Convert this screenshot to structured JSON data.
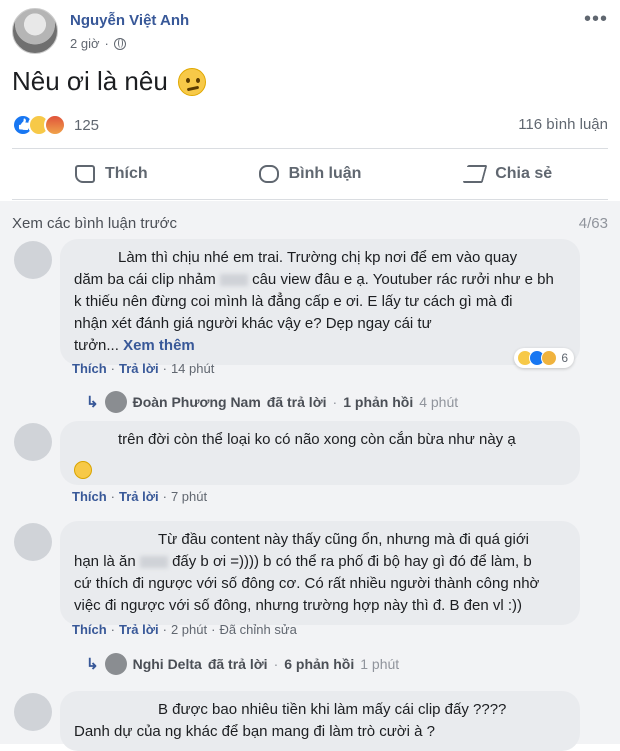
{
  "post": {
    "author": "Nguyễn Việt Anh",
    "time": "2 giờ",
    "text": "Nêu ơi là nêu",
    "reaction_count": "125",
    "comment_count": "116 bình luận"
  },
  "actions": {
    "like": "Thích",
    "comment": "Bình luận",
    "share": "Chia sẻ"
  },
  "comments_header": {
    "prev_label": "Xem các bình luận trước",
    "page": "4/63"
  },
  "comments": [
    {
      "text": "Làm thì chịu nhé em trai. Trường chị kp nơi để em vào quay",
      "line2a": "dăm ba cái clip nhảm",
      "line2b": "câu view đâu e ạ. Youtuber rác rưởi như e bh",
      "line3": "k thiếu nên đừng coi mình là đẳng cấp e ơi. E lấy tư cách gì mà đi",
      "line4": "nhận xét đánh giá người khác vậy e? Dẹp ngay cái tư",
      "line5": "tưởn...",
      "see_more": "Xem thêm",
      "like": "Thích",
      "reply": "Trả lời",
      "time": "14 phút",
      "reactions": "6",
      "replies": {
        "name": "Đoàn Phương Nam",
        "verb": "đã trả lời",
        "count": "1 phản hồi",
        "time": "4 phút"
      }
    },
    {
      "text": "trên đời còn thể loại ko có não xong còn cắn bừa như này ạ",
      "like": "Thích",
      "reply": "Trả lời",
      "time": "7 phút"
    },
    {
      "line1": "Từ đầu content này thấy cũng ổn, nhưng mà đi quá giới",
      "line2a": "hạn là ăn",
      "line2b": "đấy b ơi =)))) b có thể ra phố đi bộ hay gì đó để làm, b",
      "line3": "cứ thích đi ngược với số đông cơ. Có rất nhiều người thành công nhờ",
      "line4": "việc đi ngược với số đông, nhưng trường hợp này thì đ. B đen vl :))",
      "like": "Thích",
      "reply": "Trả lời",
      "time": "2 phút",
      "edited": "Đã chỉnh sửa",
      "replies": {
        "name": "Nghi Delta",
        "verb": "đã trả lời",
        "count": "6 phản hồi",
        "time": "1 phút"
      }
    },
    {
      "line1": "B được bao nhiêu tiền khi làm mấy cái clip đấy ????",
      "line2": "Danh dự của ng khác để bạn mang đi làm trò cười à ?"
    }
  ]
}
